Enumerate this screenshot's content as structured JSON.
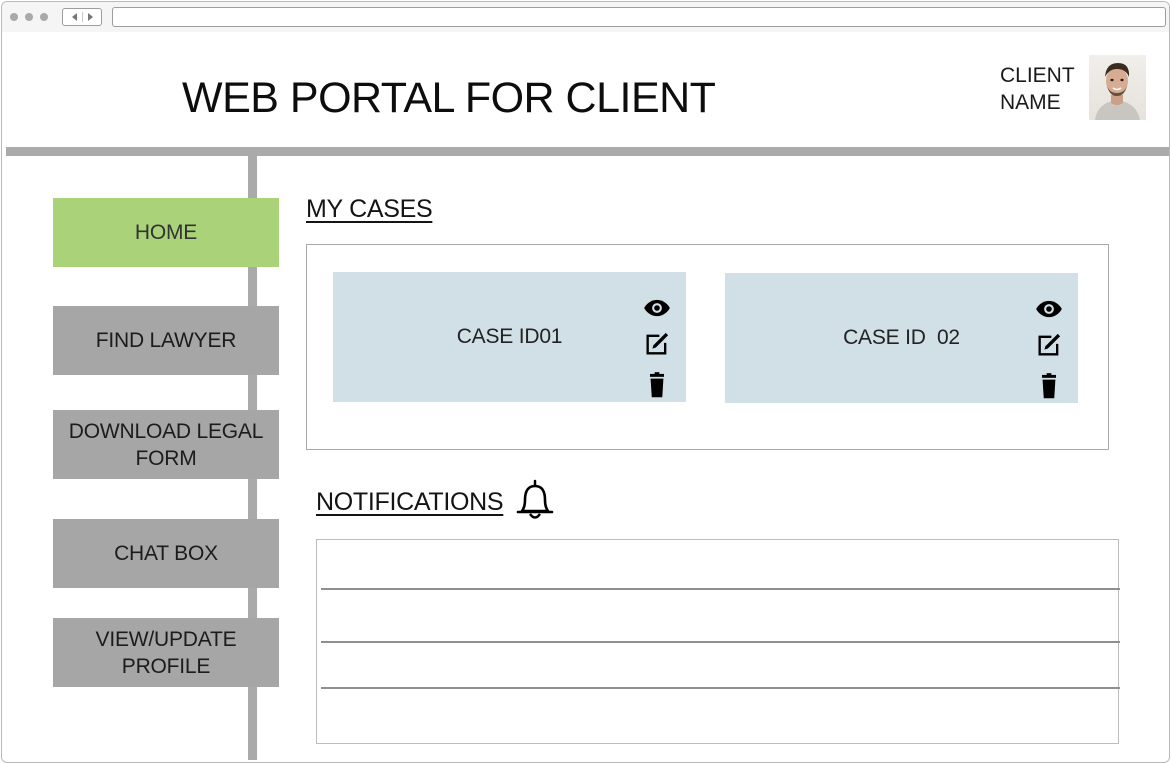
{
  "header": {
    "title": "WEB PORTAL FOR CLIENT",
    "client_name_line1": "CLIENT",
    "client_name_line2": "NAME"
  },
  "sidebar": {
    "items": [
      {
        "label": "HOME",
        "active": true
      },
      {
        "label": "FIND LAWYER",
        "active": false
      },
      {
        "label": "DOWNLOAD LEGAL FORM",
        "active": false
      },
      {
        "label": "CHAT BOX",
        "active": false
      },
      {
        "label": "VIEW/UPDATE PROFILE",
        "active": false
      }
    ]
  },
  "cases": {
    "title": "MY CASES",
    "items": [
      {
        "label": "CASE ID01"
      },
      {
        "label": "CASE ID  02"
      }
    ],
    "icons": [
      "eye-icon",
      "edit-icon",
      "trash-icon"
    ]
  },
  "notifications": {
    "title": "NOTIFICATIONS",
    "icon": "bell-icon"
  },
  "colors": {
    "active_nav": "#a9d279",
    "nav": "#a6a6a6",
    "case_card": "#d1dfe6",
    "rule": "#aaaaaa"
  }
}
